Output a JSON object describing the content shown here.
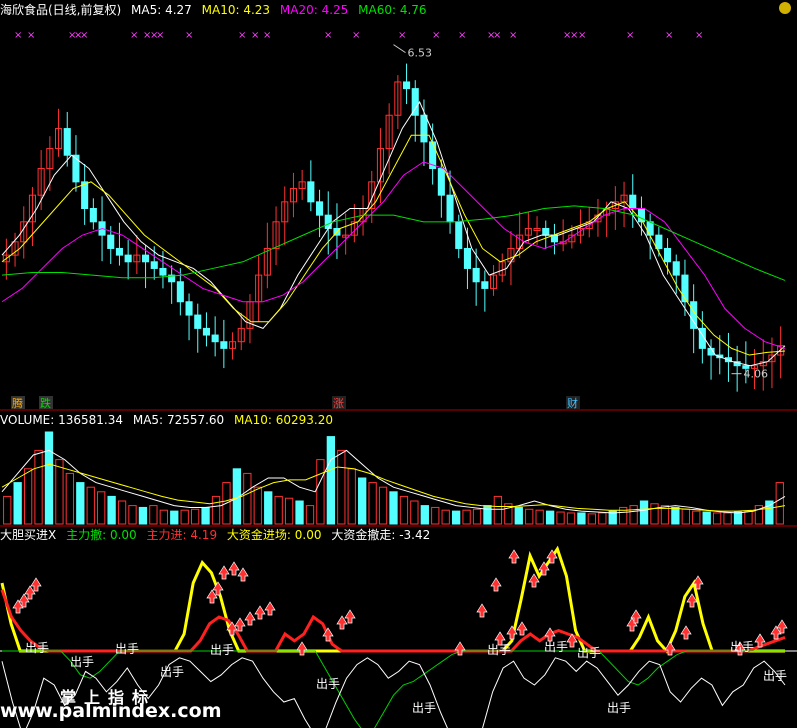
{
  "header": {
    "title": "海欣食品(日线,前复权)",
    "ma": [
      {
        "label": "MA5:",
        "value": "4.27",
        "color": "#ffffff"
      },
      {
        "label": "MA10:",
        "value": "4.23",
        "color": "#ffff00"
      },
      {
        "label": "MA20:",
        "value": "4.25",
        "color": "#ff00ff"
      },
      {
        "label": "MA60:",
        "value": "4.76",
        "color": "#00e000"
      }
    ]
  },
  "volume_header": {
    "items": [
      {
        "label": "VOLUME:",
        "value": "136581.34",
        "color": "#ffffff"
      },
      {
        "label": "MA5:",
        "value": "72557.60",
        "color": "#ffffff"
      },
      {
        "label": "MA10:",
        "value": "60293.20",
        "color": "#ffff00"
      }
    ]
  },
  "indicator_header": {
    "name": "大胆买进X",
    "items": [
      {
        "label": "主力撤:",
        "value": "0.00",
        "color": "#00e000"
      },
      {
        "label": "主力进:",
        "value": "4.19",
        "color": "#ff3030"
      },
      {
        "label": "大资金进场:",
        "value": "0.00",
        "color": "#ffff00"
      },
      {
        "label": "大资金撤走:",
        "value": "-3.42",
        "color": "#ffffff"
      }
    ]
  },
  "colors": {
    "up": "#ff3232",
    "down": "#54ffff",
    "ma5": "#ffffff",
    "ma10": "#ffff00",
    "ma20": "#ff00ff",
    "ma60": "#00e000",
    "grid": "#b00000"
  },
  "markers": {
    "tengdie": [
      "腾",
      "跌"
    ],
    "zhang": "涨",
    "cai": "财",
    "high_label": "6.53",
    "low_label": "4.06",
    "sell_label": "出手"
  },
  "watermark": {
    "line1": "掌上指标",
    "line2": "www.palmindex.com"
  },
  "chart_data": [
    {
      "type": "candlestick",
      "title": "海欣食品(日线,前复权)",
      "ylim": [
        3.9,
        6.7
      ],
      "annotations": [
        {
          "text": "6.53",
          "value": 6.53
        },
        {
          "text": "4.06",
          "value": 4.06
        }
      ],
      "close": [
        4.95,
        5.05,
        5.2,
        5.4,
        5.6,
        5.75,
        5.9,
        5.7,
        5.5,
        5.3,
        5.2,
        5.1,
        5.0,
        4.95,
        4.9,
        4.95,
        4.9,
        4.85,
        4.8,
        4.75,
        4.6,
        4.5,
        4.4,
        4.35,
        4.3,
        4.25,
        4.3,
        4.4,
        4.6,
        4.8,
        5.0,
        5.2,
        5.35,
        5.45,
        5.5,
        5.35,
        5.25,
        5.15,
        5.1,
        5.1,
        5.2,
        5.3,
        5.5,
        5.75,
        6.0,
        6.25,
        6.2,
        6.0,
        5.8,
        5.6,
        5.4,
        5.2,
        5.0,
        4.85,
        4.75,
        4.7,
        4.8,
        4.9,
        5.0,
        5.1,
        5.15,
        5.15,
        5.1,
        5.05,
        5.05,
        5.1,
        5.15,
        5.2,
        5.25,
        5.3,
        5.35,
        5.4,
        5.3,
        5.2,
        5.1,
        5.0,
        4.9,
        4.8,
        4.6,
        4.4,
        4.25,
        4.2,
        4.18,
        4.15,
        4.12,
        4.1,
        4.12,
        4.15,
        4.2,
        4.27
      ],
      "series": [
        {
          "name": "MA5",
          "values": [
            4.95,
            5.1,
            5.3,
            5.55,
            5.7,
            5.6,
            5.4,
            5.2,
            5.05,
            4.95,
            4.9,
            4.85,
            4.75,
            4.6,
            4.45,
            4.4,
            4.55,
            4.8,
            5.0,
            5.2,
            5.3,
            5.3,
            5.6,
            5.9,
            6.1,
            5.8,
            5.4,
            5.0,
            4.8,
            4.85,
            5.05,
            5.1,
            5.1,
            5.15,
            5.2,
            5.35,
            5.3,
            5.1,
            4.8,
            4.6,
            4.4,
            4.2,
            4.15,
            4.12,
            4.15,
            4.27
          ]
        },
        {
          "name": "MA10",
          "values": [
            4.9,
            5.0,
            5.15,
            5.3,
            5.45,
            5.5,
            5.4,
            5.25,
            5.1,
            5.0,
            4.9,
            4.8,
            4.7,
            4.55,
            4.45,
            4.45,
            4.6,
            4.8,
            5.0,
            5.15,
            5.2,
            5.35,
            5.6,
            5.85,
            5.85,
            5.55,
            5.25,
            5.0,
            4.9,
            4.95,
            5.05,
            5.1,
            5.15,
            5.2,
            5.3,
            5.35,
            5.2,
            4.95,
            4.7,
            4.5,
            4.35,
            4.25,
            4.2,
            4.22,
            4.23
          ]
        },
        {
          "name": "MA20",
          "values": [
            4.6,
            4.7,
            4.85,
            5.0,
            5.1,
            5.15,
            5.1,
            5.0,
            4.9,
            4.8,
            4.7,
            4.65,
            4.6,
            4.6,
            4.65,
            4.75,
            4.9,
            5.05,
            5.2,
            5.35,
            5.55,
            5.65,
            5.6,
            5.45,
            5.3,
            5.15,
            5.05,
            5.0,
            5.05,
            5.15,
            5.25,
            5.3,
            5.3,
            5.2,
            5.0,
            4.8,
            4.55,
            4.4,
            4.3,
            4.25
          ]
        },
        {
          "name": "MA60",
          "values": [
            4.8,
            4.82,
            4.82,
            4.8,
            4.78,
            4.78,
            4.8,
            4.85,
            4.9,
            5.0,
            5.1,
            5.2,
            5.25,
            5.25,
            5.2,
            5.2,
            5.22,
            5.25,
            5.3,
            5.32,
            5.3,
            5.25,
            5.15,
            5.05,
            4.95,
            4.85,
            4.76
          ]
        }
      ]
    },
    {
      "type": "bar",
      "title": "VOLUME",
      "values": [
        30,
        45,
        60,
        80,
        100,
        70,
        55,
        45,
        40,
        35,
        30,
        25,
        20,
        18,
        20,
        15,
        14,
        15,
        16,
        18,
        30,
        45,
        60,
        55,
        40,
        35,
        30,
        28,
        25,
        20,
        70,
        95,
        80,
        60,
        50,
        45,
        40,
        35,
        30,
        25,
        20,
        18,
        15,
        14,
        15,
        16,
        20,
        30,
        22,
        18,
        16,
        15,
        14,
        13,
        12,
        12,
        11,
        12,
        14,
        18,
        20,
        25,
        22,
        20,
        18,
        16,
        14,
        13,
        12,
        12,
        13,
        14,
        20,
        25,
        45
      ],
      "series": [
        {
          "name": "MA5",
          "values": [
            35,
            55,
            75,
            80,
            70,
            55,
            45,
            40,
            35,
            30,
            25,
            20,
            18,
            18,
            20,
            28,
            40,
            50,
            50,
            40,
            35,
            70,
            80,
            65,
            50,
            40,
            35,
            30,
            25,
            20,
            18,
            16,
            16,
            20,
            25,
            20,
            16,
            14,
            13,
            12,
            13,
            15,
            18,
            20,
            18,
            15,
            13,
            12,
            14,
            20,
            30
          ]
        },
        {
          "name": "MA10",
          "values": [
            40,
            50,
            60,
            65,
            60,
            55,
            50,
            45,
            40,
            35,
            30,
            26,
            24,
            22,
            25,
            30,
            38,
            45,
            48,
            48,
            55,
            62,
            60,
            55,
            48,
            42,
            36,
            30,
            26,
            22,
            20,
            19,
            19,
            20,
            21,
            19,
            17,
            16,
            15,
            15,
            16,
            17,
            17,
            16,
            15,
            14,
            14,
            15,
            17,
            20
          ]
        }
      ]
    },
    {
      "type": "line",
      "title": "大胆买进X",
      "series": [
        {
          "name": "大资金进场",
          "values": [
            2.0,
            0.8,
            0,
            0,
            0,
            0,
            0,
            0,
            0,
            0,
            0,
            0,
            0,
            0,
            0,
            0,
            0,
            0,
            0,
            0,
            0.5,
            2.0,
            2.6,
            2.3,
            1.6,
            0.6,
            0,
            0,
            0,
            0,
            0,
            0,
            0,
            0,
            0,
            0,
            0,
            0,
            0,
            0,
            0,
            0,
            0,
            0,
            0,
            0,
            0,
            0,
            0,
            0,
            0,
            0,
            0,
            0,
            0,
            0,
            0.3,
            1.5,
            2.8,
            2.2,
            2.6,
            3.0,
            2.2,
            0.6,
            0,
            0,
            0,
            0,
            0,
            0,
            0.4,
            1.0,
            0.3,
            0,
            0.6,
            1.6,
            2.0,
            0.8,
            0,
            0,
            0,
            0,
            0,
            0,
            0,
            0,
            0
          ]
        },
        {
          "name": "主力进",
          "values": [
            1.8,
            1.0,
            0.6,
            0.3,
            0.1,
            0,
            0,
            0,
            0,
            0,
            0,
            0,
            0,
            0,
            0,
            0,
            0,
            0,
            0,
            0,
            0,
            0.3,
            0.8,
            1.0,
            0.9,
            0.5,
            0,
            0,
            0,
            0,
            0.5,
            0.3,
            0.5,
            1.0,
            0.8,
            0.2,
            0,
            0,
            0,
            0,
            0,
            0,
            0,
            0,
            0,
            0,
            0,
            0,
            0,
            0,
            0,
            0,
            0,
            0,
            0,
            0.3,
            0.5,
            0.3,
            0.5,
            0.6,
            0.5,
            0.4,
            0.2,
            0,
            0,
            0,
            0,
            0,
            0,
            0,
            0,
            0,
            0,
            0,
            0,
            0,
            0,
            0,
            0,
            0,
            0.1,
            0.2,
            0.3,
            0.4
          ]
        },
        {
          "name": "主力撤",
          "values": [
            0,
            0,
            0,
            0,
            0,
            0,
            0,
            -0.3,
            -0.7,
            -0.8,
            -0.6,
            -0.3,
            0,
            0,
            0,
            0,
            0,
            0,
            0,
            0,
            0,
            0,
            0,
            0,
            0,
            0,
            0,
            0,
            0,
            0,
            0,
            0,
            0,
            -0.5,
            -1.0,
            -1.5,
            -2.0,
            -2.4,
            -2.3,
            -1.8,
            -1.3,
            -1.0,
            -0.9,
            -0.7,
            -0.5,
            -0.3,
            -0.1,
            0,
            0,
            0,
            0,
            0,
            0,
            0,
            0,
            0,
            0,
            0,
            0,
            0,
            0,
            0,
            -0.3,
            -0.6,
            -0.9,
            -1.0,
            -0.8,
            -0.5,
            -0.3,
            -0.1,
            0,
            0,
            0,
            0,
            0,
            0,
            0,
            0,
            0,
            0,
            0
          ]
        },
        {
          "name": "大资金撤走",
          "values": [
            -0.3,
            -1.5,
            -2.5,
            -1.8,
            -0.8,
            -1.0,
            -1.6,
            -1.3,
            -0.6,
            -0.8,
            -1.2,
            -0.9,
            -0.5,
            -1.0,
            -1.4,
            -1.0,
            -0.4,
            -0.2,
            -0.3,
            -0.6,
            -0.9,
            -0.7,
            -0.4,
            -0.2,
            -0.3,
            -0.8,
            -1.2,
            -1.5,
            -1.4,
            -2.0,
            -2.5,
            -2.3,
            -1.5,
            -0.8,
            -0.4,
            -0.2,
            -0.4,
            -0.8,
            -0.6,
            -0.3,
            -0.4,
            -1.0,
            -1.8,
            -2.5,
            -3.2,
            -2.8,
            -2.3,
            -1.2,
            -0.5,
            -0.3,
            -0.8,
            -1.0,
            -0.7,
            -0.2,
            -0.3,
            -0.6,
            -0.3,
            -0.5,
            -0.9,
            -1.3,
            -1.0,
            -0.6,
            -0.3,
            -0.4,
            -1.2,
            -1.5,
            -1.1,
            -0.8,
            -1.0,
            -1.6,
            -1.2,
            -1.0,
            -0.5,
            -0.3,
            -0.6,
            -1.0
          ]
        }
      ]
    }
  ]
}
